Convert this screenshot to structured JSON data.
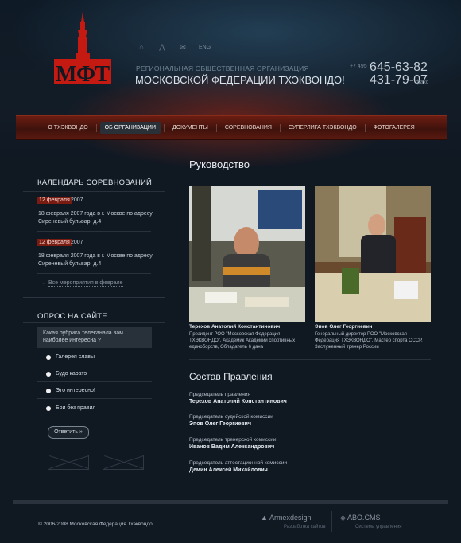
{
  "header": {
    "lang": "ENG",
    "org_line1": "РЕГИОНАЛЬНАЯ ОБЩЕСТВЕННАЯ ОРГАНИЗАЦИЯ",
    "org_line2": "МОСКОВСКОЙ ФЕДЕРАЦИИ ТХЭКВОНДО!",
    "phone_code": "+7 495",
    "phone1": "645-63-82",
    "phone2": "431-79-07",
    "fax_label": "факс",
    "logo_text": "МФТ",
    "icons": [
      "home-icon",
      "sitemap-icon",
      "mail-icon"
    ]
  },
  "nav": [
    {
      "label": "О ТХЭКВОНДО",
      "active": false
    },
    {
      "label": "ОБ ОРГАНИЗАЦИИ",
      "active": true
    },
    {
      "label": "ДОКУМЕНТЫ",
      "active": false
    },
    {
      "label": "СОРЕВНОВАНИЯ",
      "active": false
    },
    {
      "label": "СУПЕРЛИГА ТХЭКВОНДО",
      "active": false
    },
    {
      "label": "ФОТОГАЛЕРЕЯ",
      "active": false
    }
  ],
  "calendar": {
    "title": "КАЛЕНДАРЬ СОРЕВНОВАНИЙ",
    "events": [
      {
        "date": "12 февраля",
        "year": "2007",
        "text": "18 февраля 2007 года в г. Москве по адресу Сиреневый бульвар, д.4"
      },
      {
        "date": "12 февраля",
        "year": "2007",
        "text": "18 февраля 2007 года в г. Москве по адресу Сиреневый бульвар, д.4"
      }
    ],
    "all_link": "Все мероприятия в феврале"
  },
  "poll": {
    "title": "ОПРОС НА САЙТЕ",
    "question": "Какая рубрика телеканала вам наиболее интересна ?",
    "options": [
      "Галерея славы",
      "Будо каратэ",
      "Это интересно!",
      "Бои без правил"
    ],
    "button": "Ответить »"
  },
  "main": {
    "title": "Руководство",
    "people": [
      {
        "name": "Терехов Анатолий Константинович",
        "desc": "Президент РОО \"Московская Федерация ТХЭКВОНДО\", Академик Академии спортивных единоборств, Обладатель 6 дана"
      },
      {
        "name": "Эпов Олег Георгиевич",
        "desc": "Генеральный директор РОО \"Московская Федерация ТХЭКВОНДО\", Мастер спорта СССР, Заслуженный тренер России"
      }
    ],
    "board_title": "Состав Правления",
    "board": [
      {
        "role": "Председатель правления",
        "name": "Терехов Анатолий Константинович"
      },
      {
        "role": "Председатель судейской  комиссии",
        "name": "Эпов Олег Георгиевич"
      },
      {
        "role": "Председатель тренерской комиссии",
        "name": "Иванов Вадим Александрович"
      },
      {
        "role": "Председатель аттестационной комиссии",
        "name": "Демин Алексей Михайлович"
      }
    ]
  },
  "footer": {
    "copyright": "© 2006-2008 Московская Федерация Тхэквондо",
    "dev1_name": "Armexdesign",
    "dev1_sub": "Разработка сайтов",
    "dev2_name": "ABO.CMS",
    "dev2_sub": "Система управления"
  },
  "colors": {
    "accent": "#7a1b12",
    "background": "#101822"
  }
}
